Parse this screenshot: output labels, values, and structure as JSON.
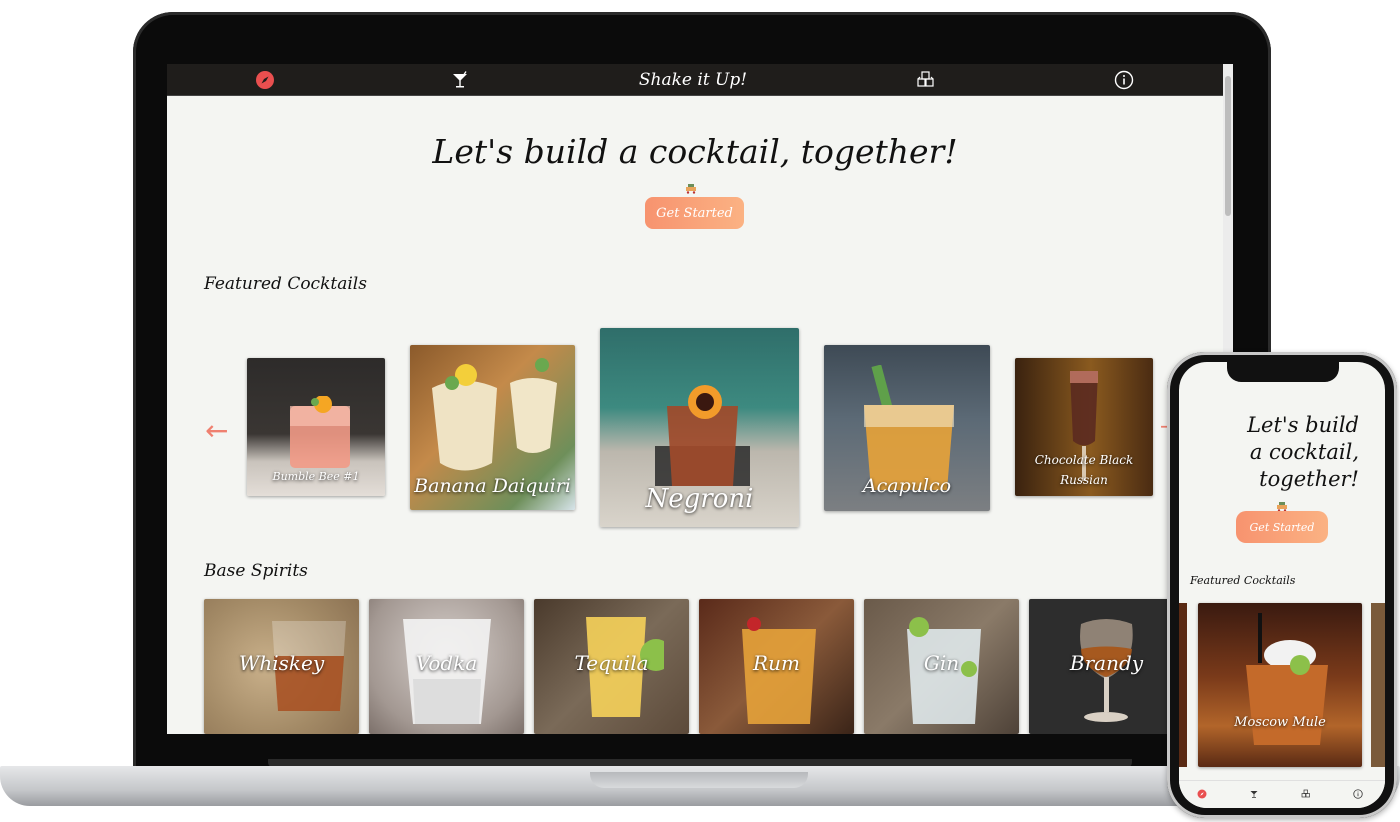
{
  "laptop": {
    "nav": {
      "brand": "Shake it Up!"
    },
    "hero": {
      "title": "Let's build a cocktail, together!",
      "button": "Get Started"
    },
    "featured": {
      "heading": "Featured Cocktails",
      "cocktails": [
        {
          "name": "Bumble Bee #1"
        },
        {
          "name": "Banana Daiquiri"
        },
        {
          "name": "Negroni"
        },
        {
          "name": "Acapulco"
        },
        {
          "name": "Chocolate Black Russian"
        }
      ]
    },
    "spirits": {
      "heading": "Base Spirits",
      "items": [
        {
          "name": "Whiskey"
        },
        {
          "name": "Vodka"
        },
        {
          "name": "Tequila"
        },
        {
          "name": "Rum"
        },
        {
          "name": "Gin"
        },
        {
          "name": "Brandy"
        }
      ]
    }
  },
  "phone": {
    "hero": {
      "title_lines": [
        "Let's build",
        "a cocktail,",
        "together!"
      ],
      "button": "Get Started"
    },
    "featured": {
      "heading": "Featured Cocktails",
      "cocktail": "Moscow Mule"
    }
  },
  "colors": {
    "accent": "#f08b6e",
    "nav_bg": "#1f1d1b",
    "page_bg": "#f4f5f2"
  },
  "icons": {
    "nav": [
      "compass-icon",
      "cocktail-glass-icon",
      "ice-cubes-icon",
      "info-icon"
    ]
  }
}
